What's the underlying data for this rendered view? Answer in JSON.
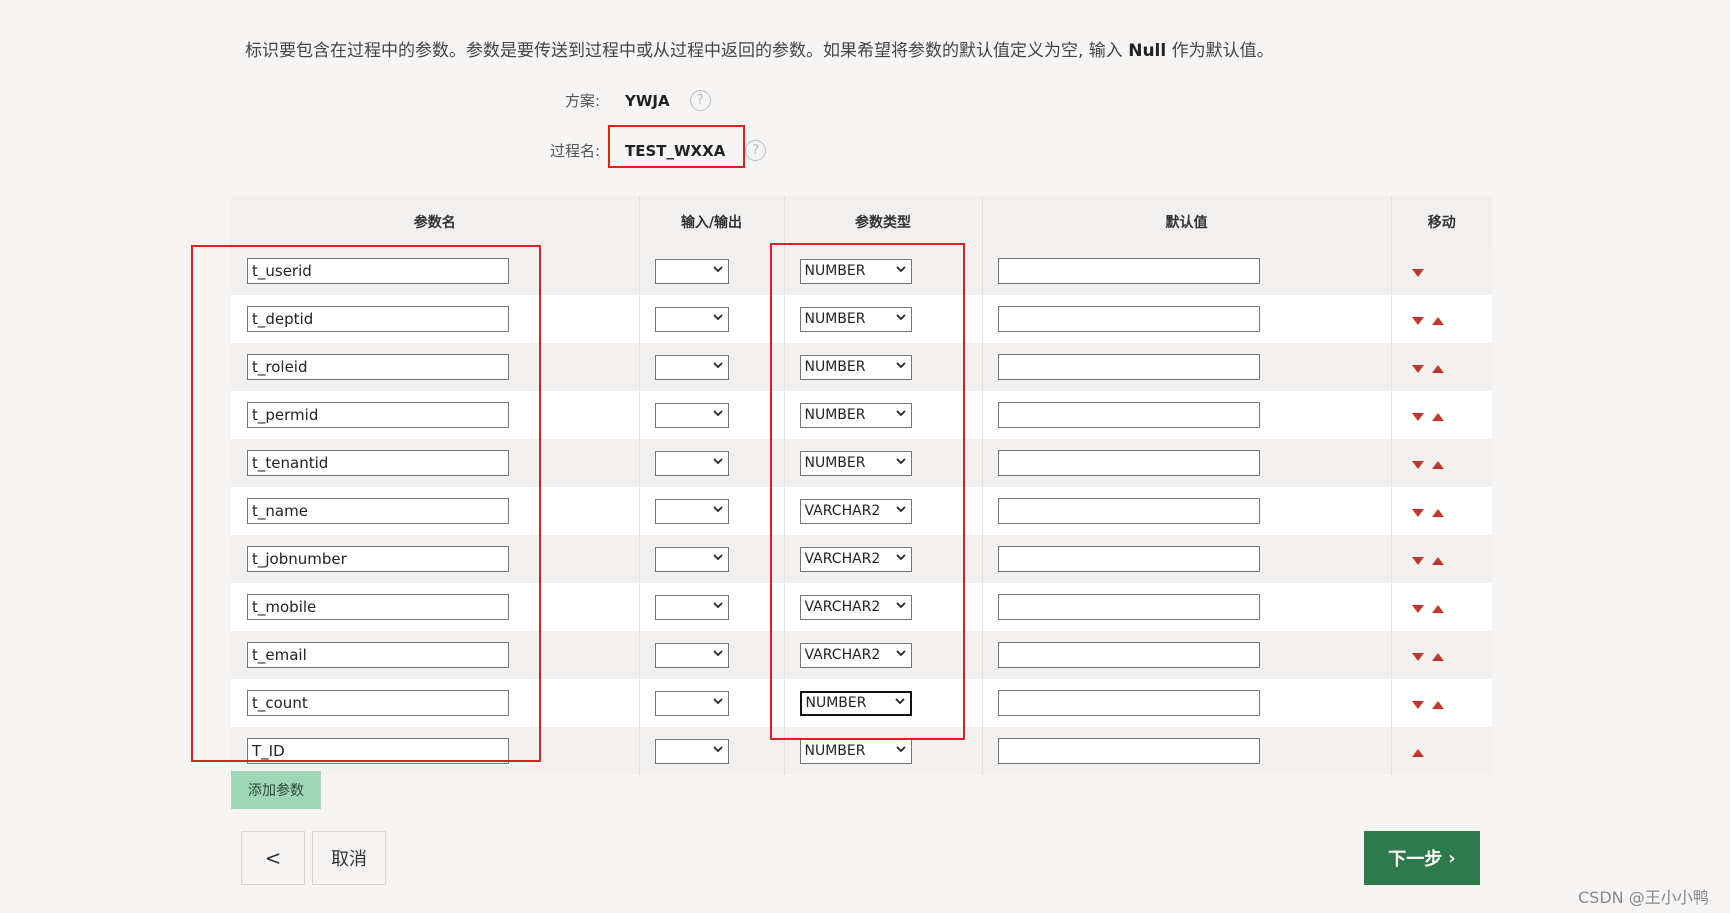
{
  "intro": {
    "part1": "标识要包含在过程中的参数。参数是要传送到过程中或从过程中返回的参数。如果希望将参数的默认值定义为空, 输入 ",
    "null_word": "Null",
    "part2": " 作为默认值。"
  },
  "scheme": {
    "label": "方案:",
    "value": "YWJA"
  },
  "procedure": {
    "label": "过程名:",
    "value": "TEST_WXXA"
  },
  "table": {
    "headers": [
      "参数名",
      "输入/输出",
      "参数类型",
      "默认值",
      "移动"
    ],
    "rows": [
      {
        "name": "t_userid",
        "io": "",
        "type": "NUMBER",
        "default": ""
      },
      {
        "name": "t_deptid",
        "io": "",
        "type": "NUMBER",
        "default": ""
      },
      {
        "name": "t_roleid",
        "io": "",
        "type": "NUMBER",
        "default": ""
      },
      {
        "name": "t_permid",
        "io": "",
        "type": "NUMBER",
        "default": ""
      },
      {
        "name": "t_tenantid",
        "io": "",
        "type": "NUMBER",
        "default": ""
      },
      {
        "name": "t_name",
        "io": "",
        "type": "VARCHAR2",
        "default": ""
      },
      {
        "name": "t_jobnumber",
        "io": "",
        "type": "VARCHAR2",
        "default": ""
      },
      {
        "name": "t_mobile",
        "io": "",
        "type": "VARCHAR2",
        "default": ""
      },
      {
        "name": "t_email",
        "io": "",
        "type": "VARCHAR2",
        "default": ""
      },
      {
        "name": "t_count",
        "io": "",
        "type": "NUMBER",
        "default": ""
      },
      {
        "name": "T_ID",
        "io": "",
        "type": "NUMBER",
        "default": ""
      }
    ]
  },
  "buttons": {
    "add_param": "添加参数",
    "back": "<",
    "cancel": "取消",
    "next": "下一步",
    "next_chevron": "›"
  },
  "help_icon": "?",
  "watermark": "CSDN @王小小鸭",
  "colors": {
    "annotation_red": "#e02020",
    "primary_green": "#2f7a4d",
    "add_button_green": "#9fd6b5",
    "move_arrow_red": "#c0392b"
  }
}
